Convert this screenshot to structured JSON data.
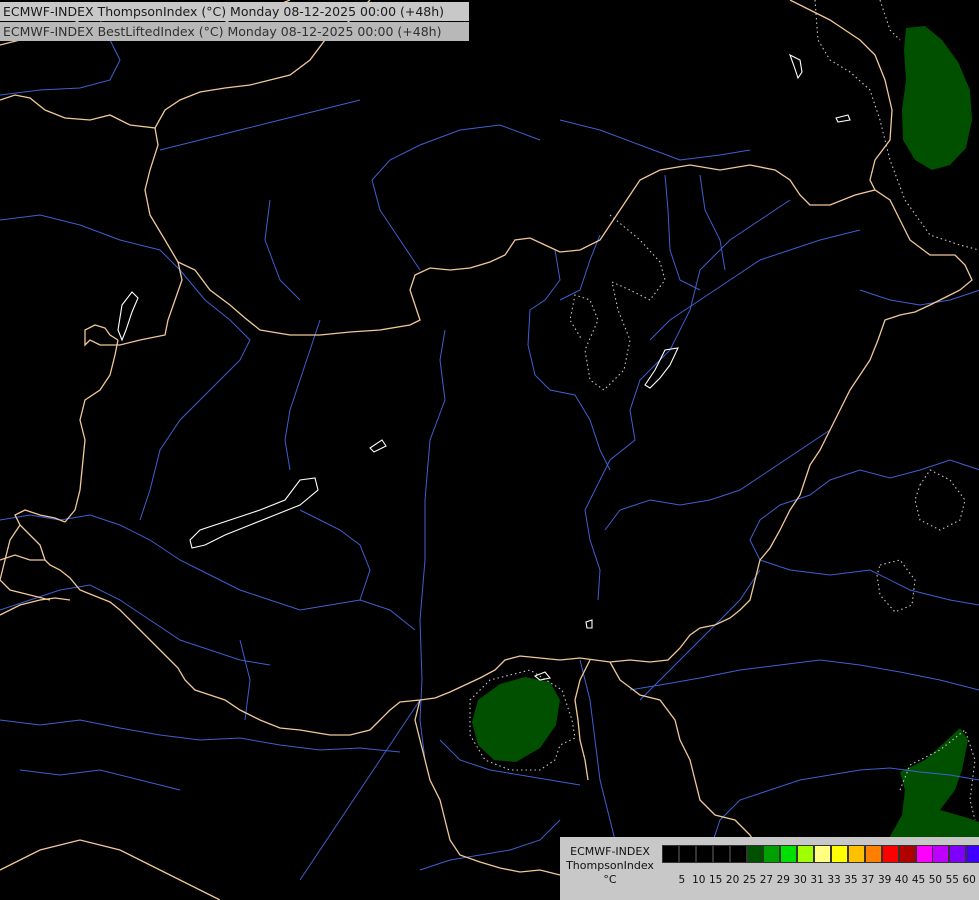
{
  "title": {
    "line1": "ECMWF-INDEX ThompsonIndex (°C) Monday 08-12-2025 00:00 (+48h)",
    "line2": "ECMWF-INDEX BestLiftedIndex (°C) Monday 08-12-2025 00:00 (+48h)"
  },
  "colors": {
    "background": "#000000",
    "border": "#f0c89a",
    "river": "#3f5fd0",
    "lake": "#ffffff",
    "contour": "#c8c8c8",
    "fill_20": "#005000"
  },
  "legend": {
    "title": "ECMWF-INDEX",
    "variable": "ThompsonIndex",
    "unit": "°C",
    "colors": [
      "#000000",
      "#000000",
      "#000000",
      "#000000",
      "#000000",
      "#005000",
      "#00a000",
      "#00e000",
      "#a0ff00",
      "#ffff80",
      "#ffff00",
      "#ffc000",
      "#ff8000",
      "#ff0000",
      "#b00000",
      "#ff00ff",
      "#c000ff",
      "#8000ff",
      "#4000ff",
      "#0000ff"
    ],
    "ticks": [
      "5",
      "10",
      "15",
      "20",
      "25",
      "27",
      "29",
      "30",
      "31",
      "33",
      "35",
      "37",
      "39",
      "40",
      "45",
      "50",
      "55",
      "60"
    ]
  }
}
